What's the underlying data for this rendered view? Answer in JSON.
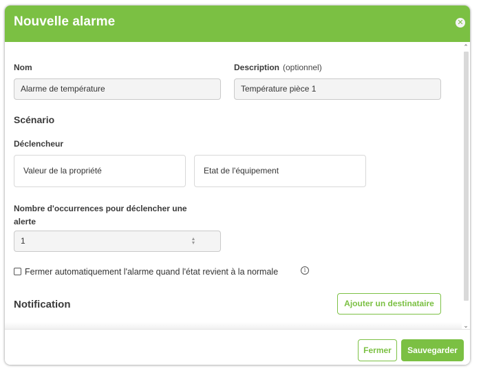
{
  "modal": {
    "title": "Nouvelle alarme",
    "close_glyph": "✕"
  },
  "form": {
    "name_label": "Nom",
    "name_value": "Alarme de température",
    "description_label": "Description",
    "description_optional": "(optionnel)",
    "description_value": "Température pièce 1",
    "scenario_title": "Scénario",
    "trigger_label": "Déclencheur",
    "trigger_options": [
      "Valeur de la propriété",
      "Etat de l'équipement"
    ],
    "occurrences_label_line1": "Nombre d'occurrences pour déclencher une",
    "occurrences_label_line2": "alerte",
    "occurrences_value": "1",
    "autoclose_label": "Fermer automatiquement l'alarme quand l'état revient à la normale",
    "autoclose_checked": false,
    "notification_title": "Notification",
    "add_recipient_label": "Ajouter un destinataire"
  },
  "footer": {
    "close_label": "Fermer",
    "save_label": "Sauvegarder"
  },
  "colors": {
    "accent": "#7bc043",
    "input_bg": "#f4f4f4",
    "border": "#c9c9c9"
  },
  "icons": {
    "close": "close-circle-icon",
    "info": "info-circle-icon",
    "spinner": "number-spinner-icon",
    "scroll_up": "chevron-up-icon",
    "scroll_down": "chevron-down-icon"
  }
}
